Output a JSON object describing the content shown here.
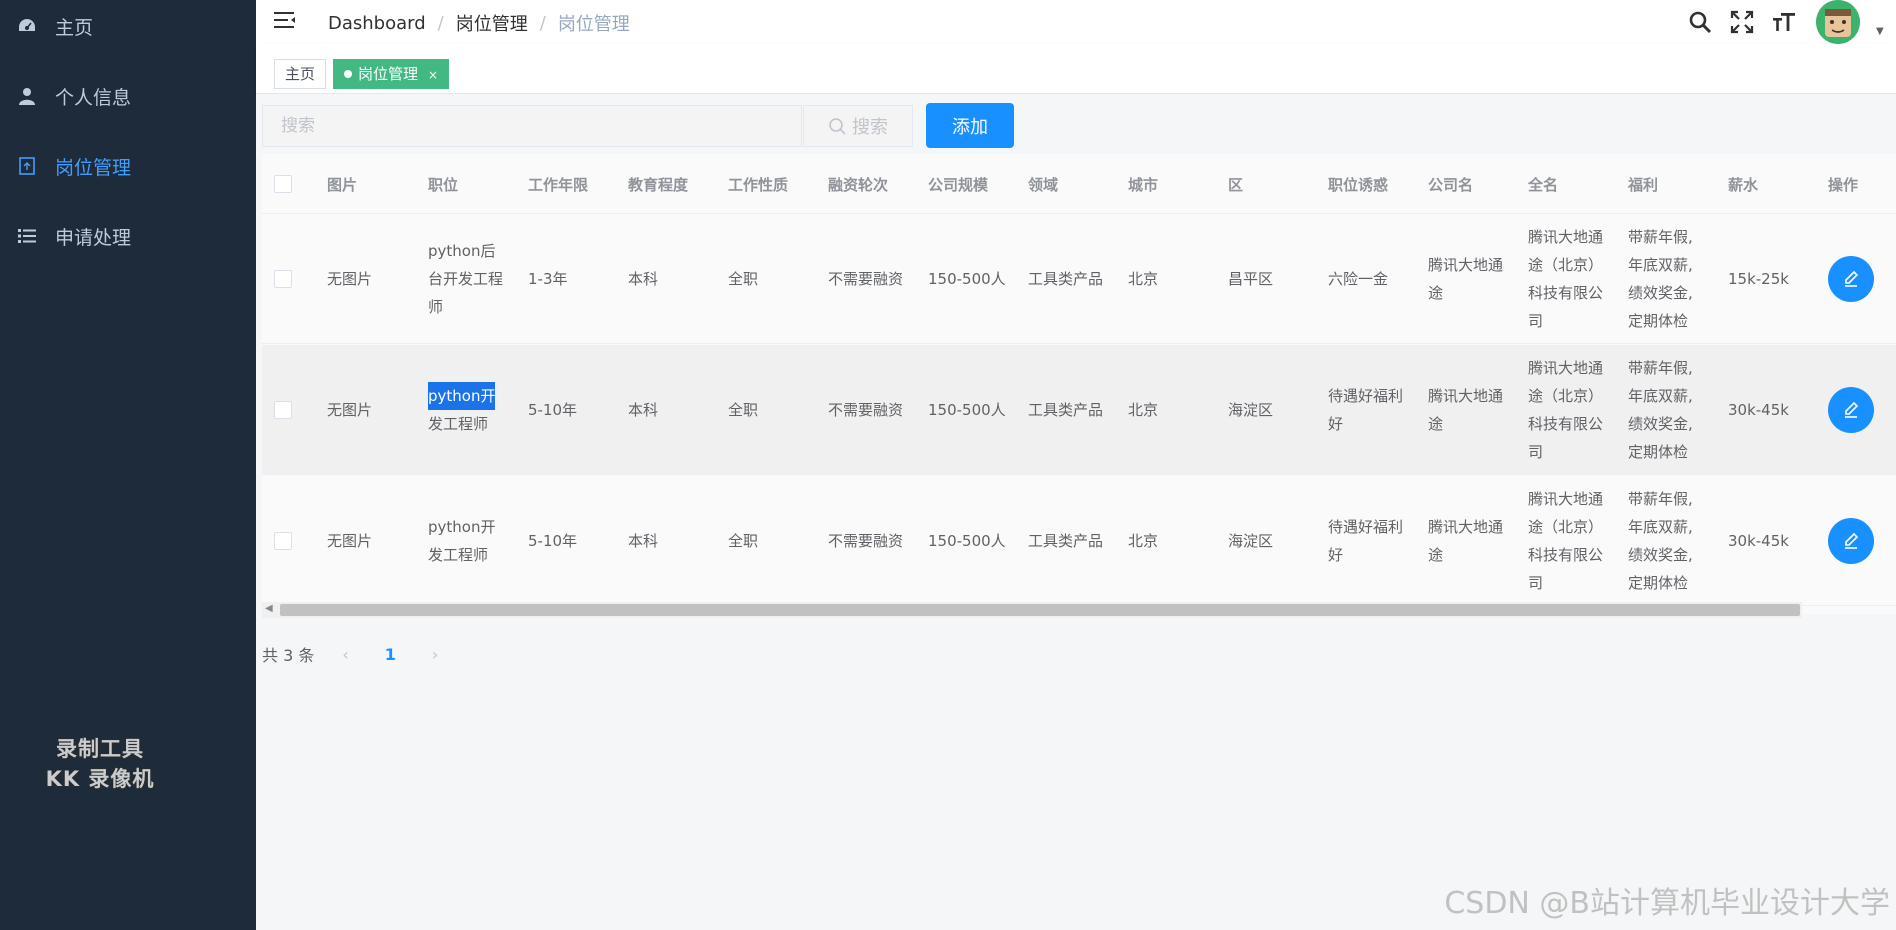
{
  "sidebar": {
    "items": [
      {
        "label": "主页",
        "icon": "dashboard-icon"
      },
      {
        "label": "个人信息",
        "icon": "user-icon"
      },
      {
        "label": "岗位管理",
        "icon": "document-icon",
        "active": true
      },
      {
        "label": "申请处理",
        "icon": "list-icon"
      }
    ],
    "watermark_line1": "录制工具",
    "watermark_line2": "KK 录像机"
  },
  "header": {
    "breadcrumb": [
      "Dashboard",
      "岗位管理",
      "岗位管理"
    ]
  },
  "tags": [
    {
      "label": "主页",
      "active": false
    },
    {
      "label": "岗位管理",
      "active": true,
      "close": "×"
    }
  ],
  "toolbar": {
    "search_placeholder": "搜索",
    "search_button": "搜索",
    "add_button": "添加"
  },
  "table": {
    "columns": [
      "图片",
      "职位",
      "工作年限",
      "教育程度",
      "工作性质",
      "融资轮次",
      "公司规模",
      "领域",
      "城市",
      "区",
      "职位诱惑",
      "公司名",
      "全名",
      "福利",
      "薪水",
      "操作"
    ],
    "rows": [
      {
        "image": "无图片",
        "position": [
          "python后",
          "台开发工程",
          "师"
        ],
        "years": "1-3年",
        "education": "本科",
        "nature": "全职",
        "funding": "不需要融资",
        "size": "150-500人",
        "field": "工具类产品",
        "city": "北京",
        "district": "昌平区",
        "temptation": [
          "六险一金"
        ],
        "company": [
          "腾讯大地通",
          "途"
        ],
        "fullname": [
          "腾讯大地通",
          "途（北京）",
          "科技有限公",
          "司"
        ],
        "welfare": [
          "带薪年假,",
          "年底双薪,",
          "绩效奖金,",
          "定期体检"
        ],
        "salary": "15k-25k"
      },
      {
        "image": "无图片",
        "position": [
          "python开",
          "发工程师"
        ],
        "years": "5-10年",
        "education": "本科",
        "nature": "全职",
        "funding": "不需要融资",
        "size": "150-500人",
        "field": "工具类产品",
        "city": "北京",
        "district": "海淀区",
        "temptation": [
          "待遇好福利",
          "好"
        ],
        "company": [
          "腾讯大地通",
          "途"
        ],
        "fullname": [
          "腾讯大地通",
          "途（北京）",
          "科技有限公",
          "司"
        ],
        "welfare": [
          "带薪年假,",
          "年底双薪,",
          "绩效奖金,",
          "定期体检"
        ],
        "salary": "30k-45k"
      },
      {
        "image": "无图片",
        "position": [
          "python开",
          "发工程师"
        ],
        "years": "5-10年",
        "education": "本科",
        "nature": "全职",
        "funding": "不需要融资",
        "size": "150-500人",
        "field": "工具类产品",
        "city": "北京",
        "district": "海淀区",
        "temptation": [
          "待遇好福利",
          "好"
        ],
        "company": [
          "腾讯大地通",
          "途"
        ],
        "fullname": [
          "腾讯大地通",
          "途（北京）",
          "科技有限公",
          "司"
        ],
        "welfare": [
          "带薪年假,",
          "年底双薪,",
          "绩效奖金,",
          "定期体检"
        ],
        "salary": "30k-45k"
      }
    ]
  },
  "pagination": {
    "total_text": "共 3 条",
    "prev": "‹",
    "current": "1",
    "next": "›"
  },
  "watermark": "CSDN @B站计算机毕业设计大学",
  "colors": {
    "sidebar_bg": "#1d2b3a",
    "accent": "#1890ff",
    "active_tag": "#42b983"
  }
}
